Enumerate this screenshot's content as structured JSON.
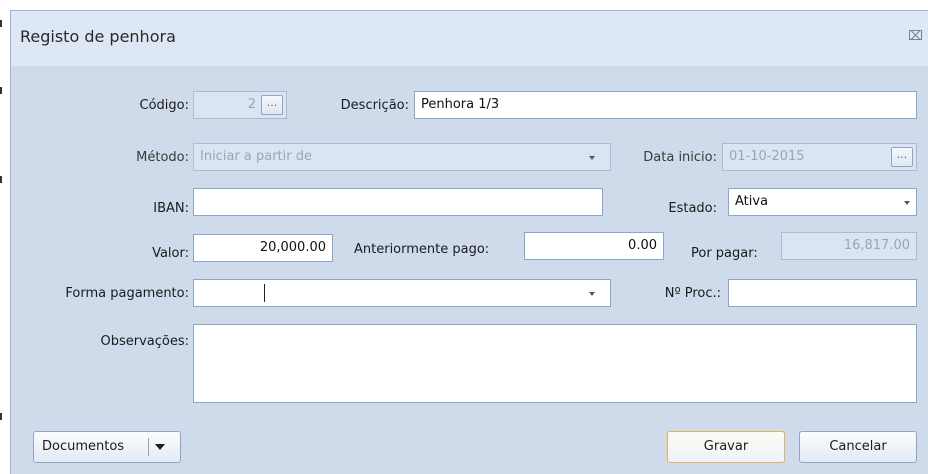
{
  "window": {
    "title": "Registo de penhora",
    "close_icon": "close-icon"
  },
  "form": {
    "codigo": {
      "label": "Código:",
      "value": "2",
      "browse_label": "..."
    },
    "descricao": {
      "label": "Descrição:",
      "value": "Penhora 1/3"
    },
    "metodo": {
      "label": "Método:",
      "value": "Iniciar a partir de"
    },
    "data_inicio": {
      "label": "Data inicio:",
      "value": "01-10-2015",
      "browse_label": "..."
    },
    "iban": {
      "label": "IBAN:",
      "value": ""
    },
    "estado": {
      "label": "Estado:",
      "value": "Ativa"
    },
    "valor": {
      "label": "Valor:",
      "value": "20,000.00"
    },
    "anteriormente_pago": {
      "label": "Anteriormente pago:",
      "value": "0.00"
    },
    "por_pagar": {
      "label": "Por pagar:",
      "value": "16,817.00"
    },
    "forma_pagamento": {
      "label": "Forma pagamento:",
      "value": ""
    },
    "n_proc": {
      "label": "Nº Proc.:",
      "value": ""
    },
    "observacoes": {
      "label": "Observações:",
      "value": ""
    }
  },
  "footer": {
    "documentos_label": "Documentos",
    "gravar_label": "Gravar",
    "cancelar_label": "Cancelar"
  },
  "colors": {
    "dialog_background": "#cfdbeb",
    "titlebar_background": "#dde7f5",
    "field_border": "#8ea6c6",
    "default_button_border": "#e0b25a"
  }
}
